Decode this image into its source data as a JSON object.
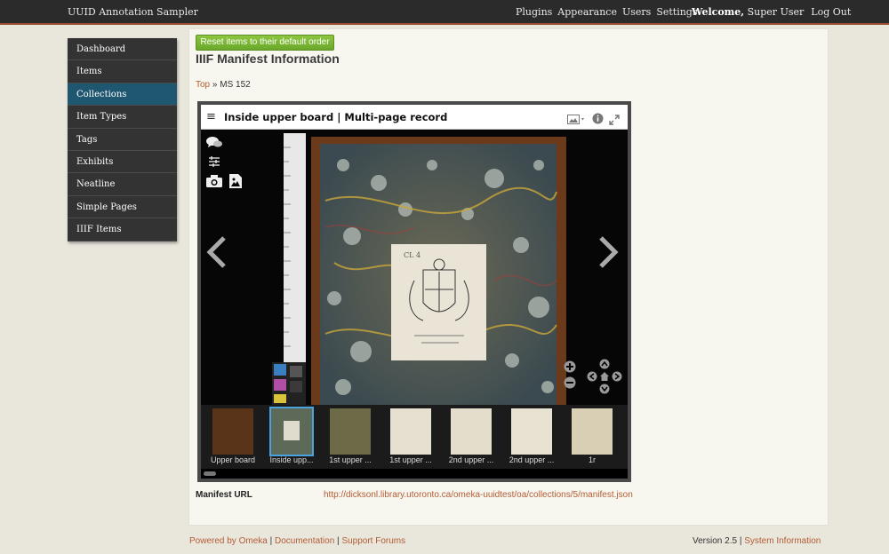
{
  "header": {
    "site_title": "UUID Annotation Sampler",
    "nav": [
      "Plugins",
      "Appearance",
      "Users",
      "Settings"
    ],
    "welcome_label": "Welcome,",
    "user_name": "Super User",
    "logout_label": "Log Out"
  },
  "sidebar": {
    "items": [
      {
        "label": "Dashboard"
      },
      {
        "label": "Items"
      },
      {
        "label": "Collections"
      },
      {
        "label": "Item Types"
      },
      {
        "label": "Tags"
      },
      {
        "label": "Exhibits"
      },
      {
        "label": "Neatline"
      },
      {
        "label": "Simple Pages"
      },
      {
        "label": "IIIF Items"
      }
    ],
    "active": "Collections",
    "active_color": "#1f5670"
  },
  "main": {
    "reset_button_label": "Reset items to their default order",
    "page_title": "IIIF Manifest Information",
    "breadcrumb": {
      "top": "Top",
      "separator": "»",
      "current": "MS 152"
    }
  },
  "viewer": {
    "title": "Inside upper board | Multi-page record",
    "bookplate_text": "CL 4",
    "icons": [
      "menu-icon",
      "image-view-icon",
      "info-icon",
      "fullscreen-icon",
      "comments-icon",
      "sliders-icon",
      "camera-icon",
      "image-icon",
      "previous-arrow-icon",
      "next-arrow-icon",
      "zoom-in-icon",
      "zoom-out-icon",
      "pan-up-icon",
      "pan-left-icon",
      "home-icon",
      "pan-right-icon",
      "pan-down-icon"
    ],
    "thumbnails": [
      {
        "label": "Upper board"
      },
      {
        "label": "Inside upp..."
      },
      {
        "label": "1st upper ..."
      },
      {
        "label": "1st upper ..."
      },
      {
        "label": "2nd upper ..."
      },
      {
        "label": "2nd upper ..."
      },
      {
        "label": "1r"
      }
    ],
    "selected_thumbnail": "Inside upp...",
    "selection_color": "#4aa3df"
  },
  "manifest": {
    "label": "Manifest URL",
    "url": "http://dicksonl.library.utoronto.ca/omeka-uuidtest/oa/collections/5/manifest.json"
  },
  "footer": {
    "powered": "Powered by Omeka",
    "documentation": "Documentation",
    "support": "Support Forums",
    "separator": "|",
    "version": "Version 2.5",
    "system_info": "System Information"
  },
  "colors": {
    "link": "#b35c35",
    "header_bg": "#2b2b2b",
    "header_accent": "#9b4f2e",
    "reset_button": "#7ab834"
  }
}
